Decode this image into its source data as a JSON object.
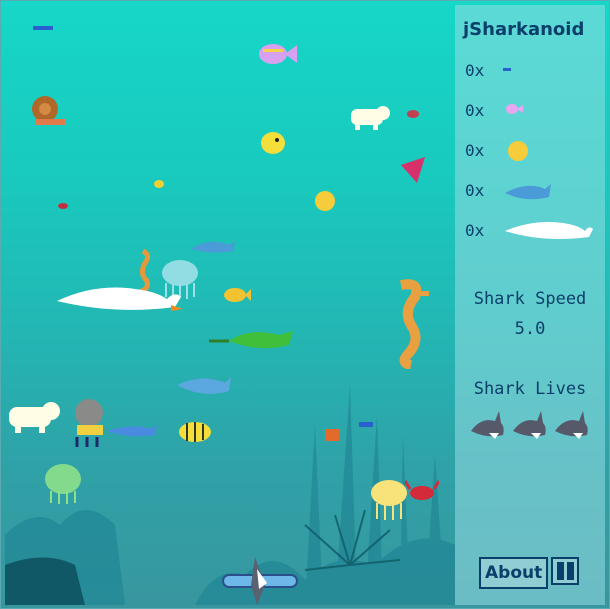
{
  "game_title": "jSharkanoid",
  "score_counts": [
    {
      "count": "0x",
      "icon": "small-fish-icon"
    },
    {
      "count": "0x",
      "icon": "pink-fish-icon"
    },
    {
      "count": "0x",
      "icon": "pufferfish-icon"
    },
    {
      "count": "0x",
      "icon": "dolphin-icon"
    },
    {
      "count": "0x",
      "icon": "swan-icon"
    }
  ],
  "speed": {
    "label": "Shark Speed",
    "value": "5.0"
  },
  "lives": {
    "label": "Shark Lives",
    "count": 3
  },
  "about_label": "About",
  "colors": {
    "panel_text": "#0b3f6b",
    "water_top": "#16d7c8",
    "water_bottom": "#38969f",
    "coral": "#1e7e8c"
  }
}
